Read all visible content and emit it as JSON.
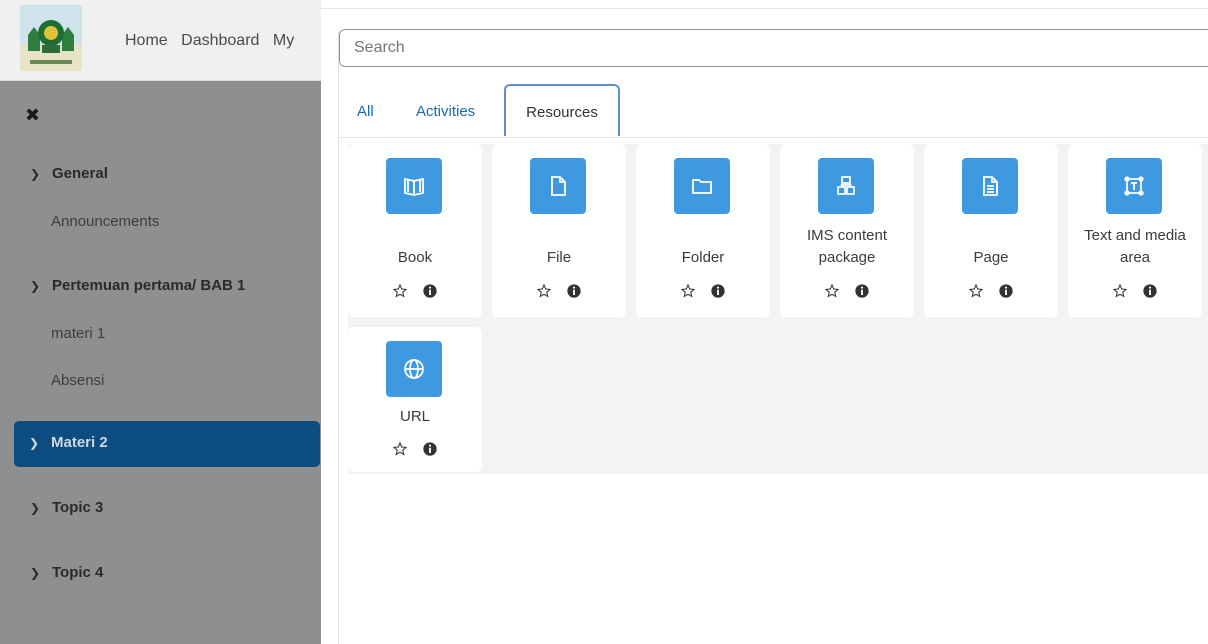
{
  "nav": {
    "links": [
      "Home",
      "Dashboard",
      "My"
    ]
  },
  "drawer": {
    "close_glyph": "✖",
    "sections": [
      {
        "label": "General",
        "items": [
          "Announcements"
        ]
      },
      {
        "label": "Pertemuan pertama/ BAB 1",
        "items": [
          "materi 1",
          "Absensi"
        ]
      },
      {
        "label": "Materi 2",
        "items": [],
        "active": true
      },
      {
        "label": "Topic 3",
        "items": []
      },
      {
        "label": "Topic 4",
        "items": []
      }
    ]
  },
  "chooser": {
    "search_placeholder": "Search",
    "tabs": [
      "All",
      "Activities",
      "Resources"
    ],
    "active_tab": "Resources",
    "modules": [
      {
        "name_lines": [
          "Book"
        ],
        "icon": "book-icon"
      },
      {
        "name_lines": [
          "File"
        ],
        "icon": "file-icon"
      },
      {
        "name_lines": [
          "Folder"
        ],
        "icon": "folder-icon"
      },
      {
        "name_lines": [
          "IMS content",
          "package"
        ],
        "icon": "ims-package-icon"
      },
      {
        "name_lines": [
          "Page"
        ],
        "icon": "page-icon"
      },
      {
        "name_lines": [
          "Text and media",
          "area"
        ],
        "icon": "text-media-icon"
      },
      {
        "name_lines": [
          "URL"
        ],
        "icon": "globe-icon"
      }
    ]
  },
  "colors": {
    "accent": "#0f6cbf",
    "icon_bg": "#3f99e0",
    "active_section_bg": "#0c4c80",
    "overlay": "#8f8f8f"
  }
}
